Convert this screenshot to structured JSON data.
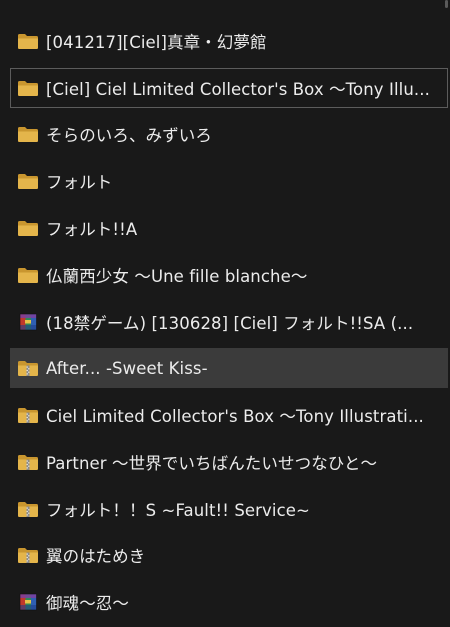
{
  "items": [
    {
      "label": "[041217][Ciel]真章・幻夢館",
      "icon": "folder-icon"
    },
    {
      "label": "[Ciel] Ciel Limited Collector's Box ～Tony Illu...",
      "icon": "folder-icon"
    },
    {
      "label": "そらのいろ、みずいろ",
      "icon": "folder-icon"
    },
    {
      "label": "フォルト",
      "icon": "folder-icon"
    },
    {
      "label": "フォルト!!A",
      "icon": "folder-icon"
    },
    {
      "label": "仏蘭西少女 ～Une fille blanche～",
      "icon": "folder-icon"
    },
    {
      "label": "(18禁ゲーム) [130628] [Ciel] フォルト!!SA (...",
      "icon": "rar-archive-icon"
    },
    {
      "label": "After... -Sweet Kiss-",
      "icon": "zip-folder-icon"
    },
    {
      "label": "Ciel Limited Collector's Box ～Tony Illustrati...",
      "icon": "zip-folder-icon"
    },
    {
      "label": "Partner ～世界でいちばんたいせつなひと～",
      "icon": "zip-folder-icon"
    },
    {
      "label": "フォルト！！S ~Fault!! Service~",
      "icon": "zip-folder-icon"
    },
    {
      "label": "翼のはためき",
      "icon": "zip-folder-icon"
    },
    {
      "label": "御魂～忍～",
      "icon": "rar-archive-icon"
    }
  ],
  "focused_index": 1,
  "selected_index": 7,
  "colors": {
    "background": "#191919",
    "selected_row": "#3b3b3b",
    "focus_border": "#5c5c5c",
    "text": "#ececec",
    "folder_yellow": "#dcb04a"
  }
}
